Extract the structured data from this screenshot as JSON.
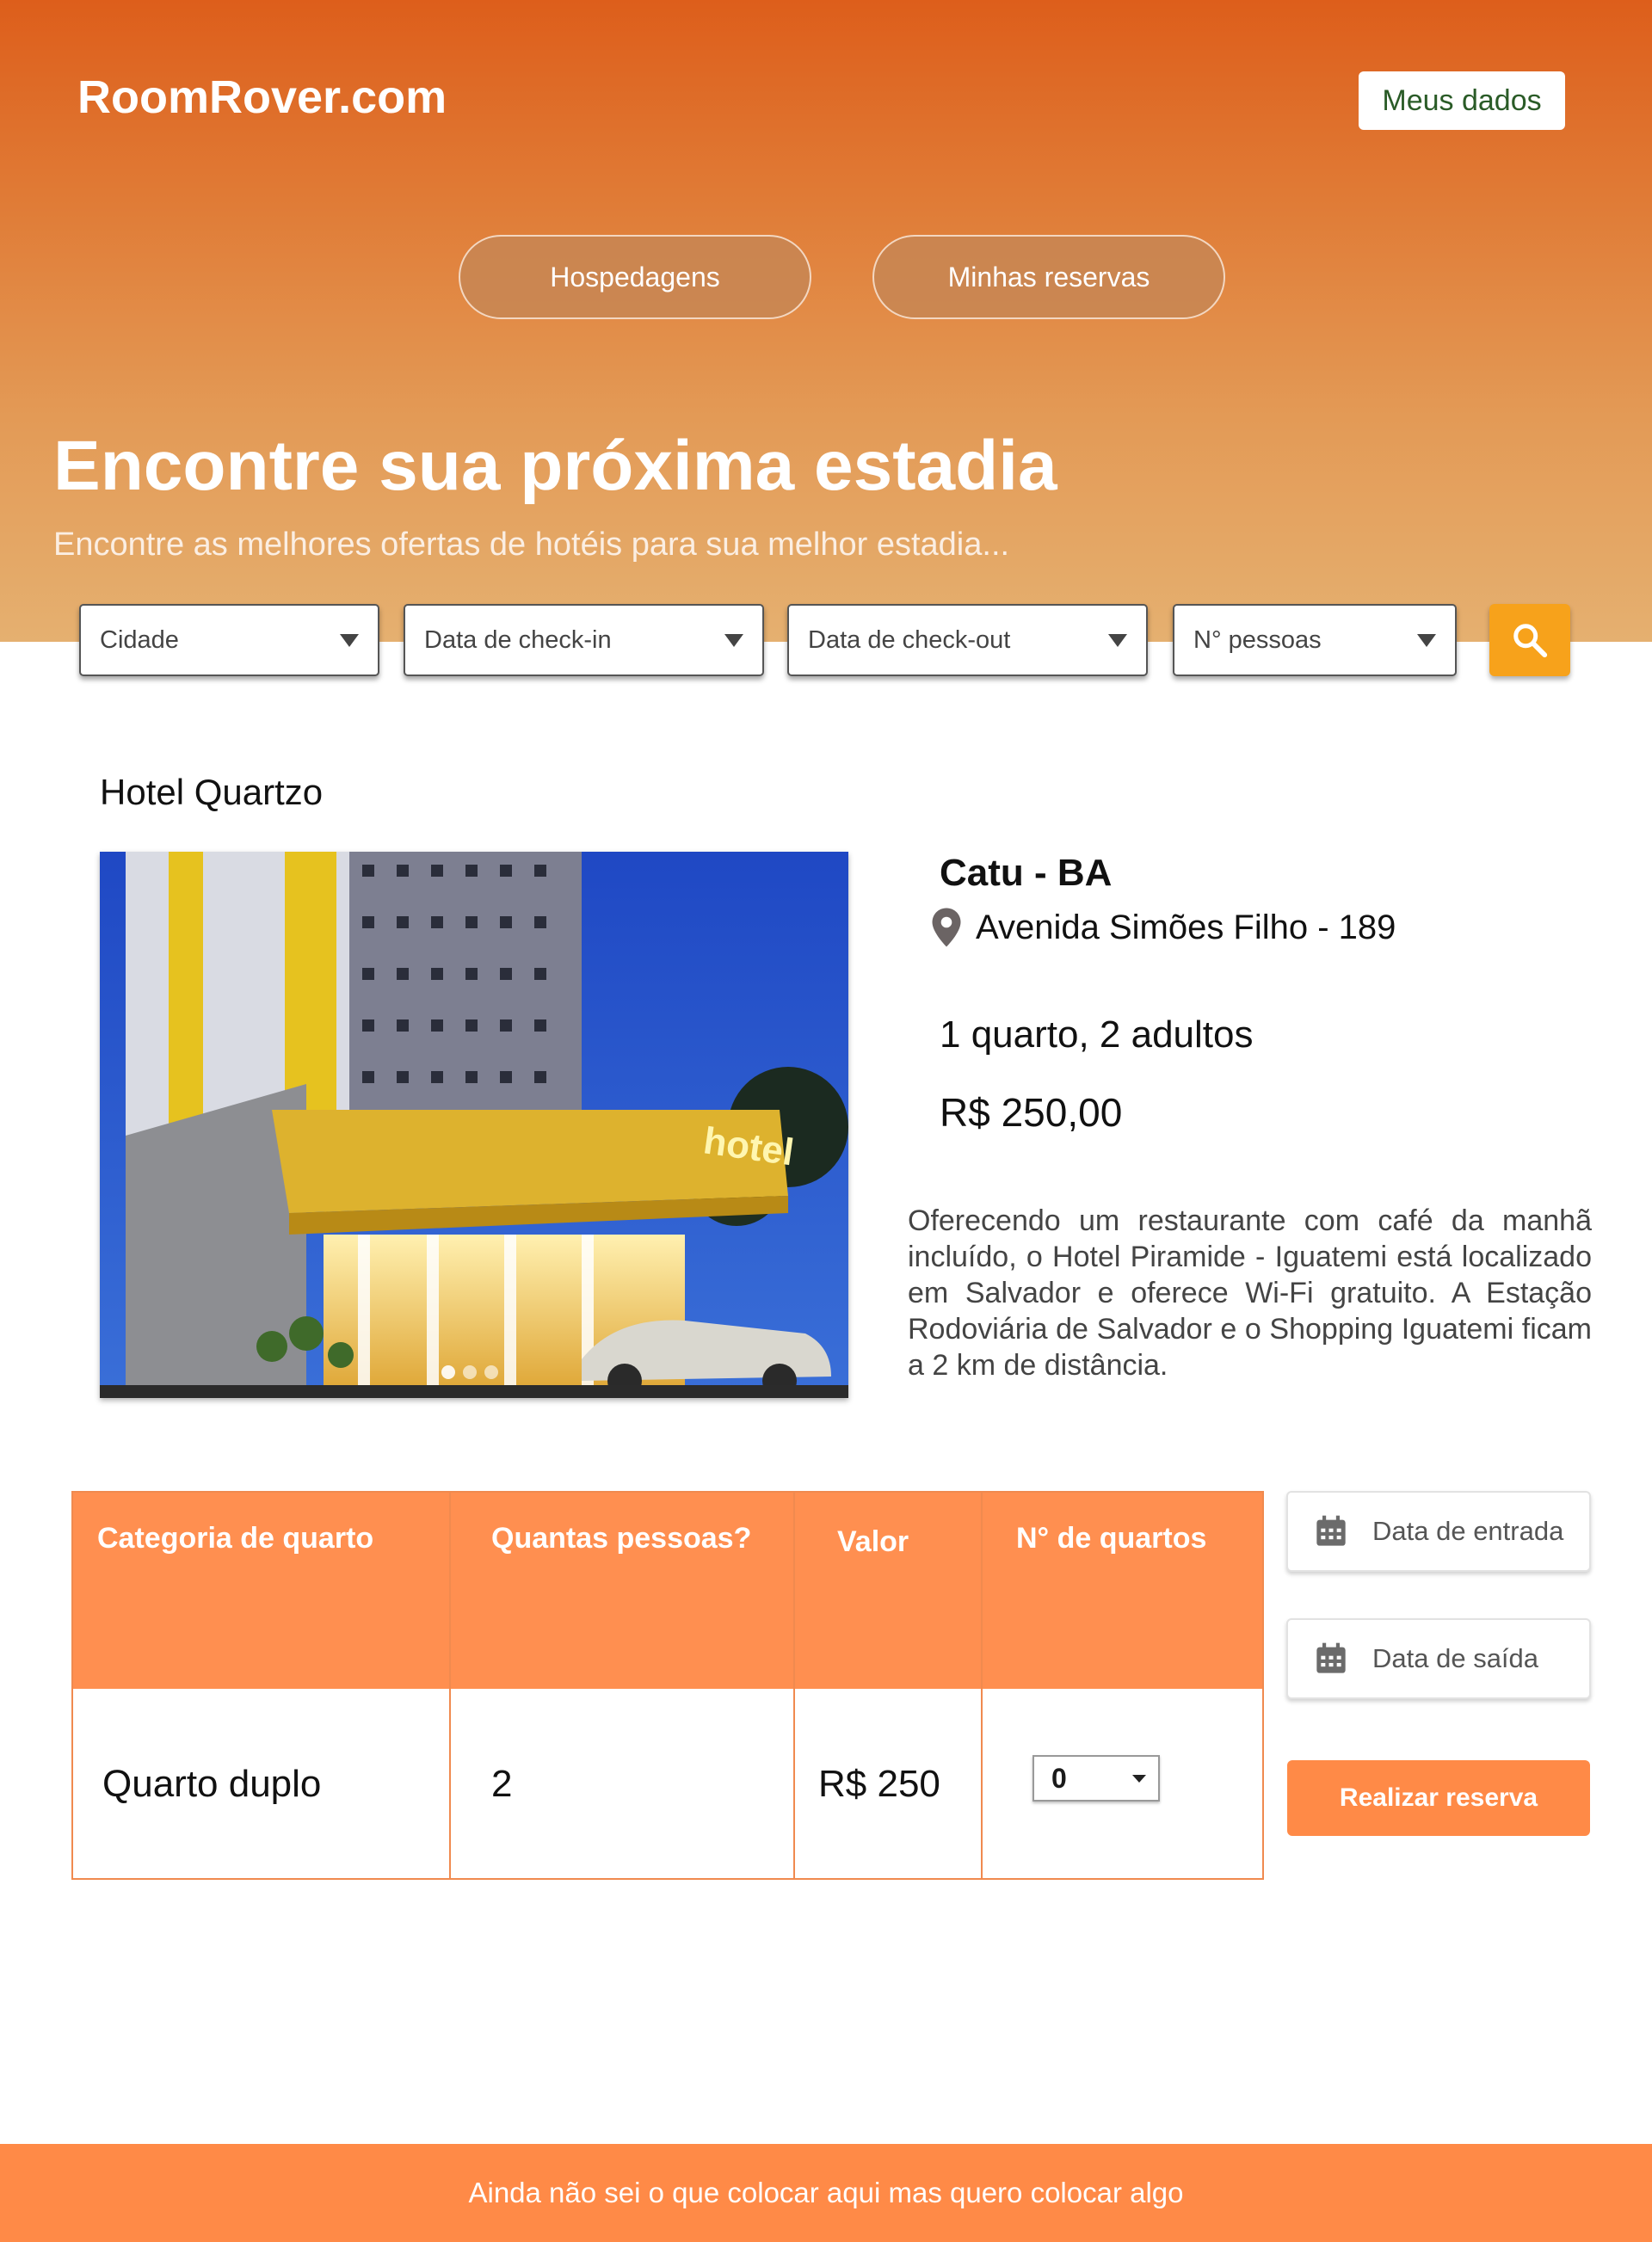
{
  "header": {
    "logo": "RoomRover.com",
    "account_button": "Meus dados",
    "nav": [
      "Hospedagens",
      "Minhas reservas"
    ]
  },
  "hero": {
    "title": "Encontre sua próxima estadia",
    "subtitle": "Encontre as melhores ofertas de hotéis para sua melhor estadia..."
  },
  "search": {
    "city": "Cidade",
    "checkin": "Data de check-in",
    "checkout": "Data de check-out",
    "guests": "N° pessoas",
    "search_icon": "search-icon"
  },
  "hotel": {
    "name": "Hotel Quartzo",
    "city": "Catu - BA",
    "address": "Avenida Simões Filho - 189",
    "occupancy": "1 quarto, 2 adultos",
    "price": "R$ 250,00",
    "sign_text": "hotel",
    "carousel_dots": 3,
    "description": "Oferecendo um restaurante com café da manhã incluído, o Hotel Piramide - Iguatemi está localizado em Salvador e oferece Wi-Fi gratuito. A Estação Rodoviária de Salvador e o Shopping Iguatemi ficam a 2 km de distância."
  },
  "rooms_table": {
    "headers": [
      "Categoria de quarto",
      "Quantas pessoas?",
      "Valor",
      "N° de quartos"
    ],
    "rows": [
      {
        "category": "Quarto duplo",
        "people": "2",
        "value": "R$ 250",
        "rooms": "0"
      }
    ]
  },
  "booking": {
    "entry_date": "Data de entrada",
    "exit_date": "Data de saída",
    "reserve_button": "Realizar reserva"
  },
  "footer": {
    "text": "Ainda não sei o que colocar aqui mas quero colocar algo"
  },
  "colors": {
    "accent": "#ff8a47",
    "header_start": "#dd5e1b",
    "header_end": "#e5b070",
    "search_button": "#f7a21b"
  }
}
